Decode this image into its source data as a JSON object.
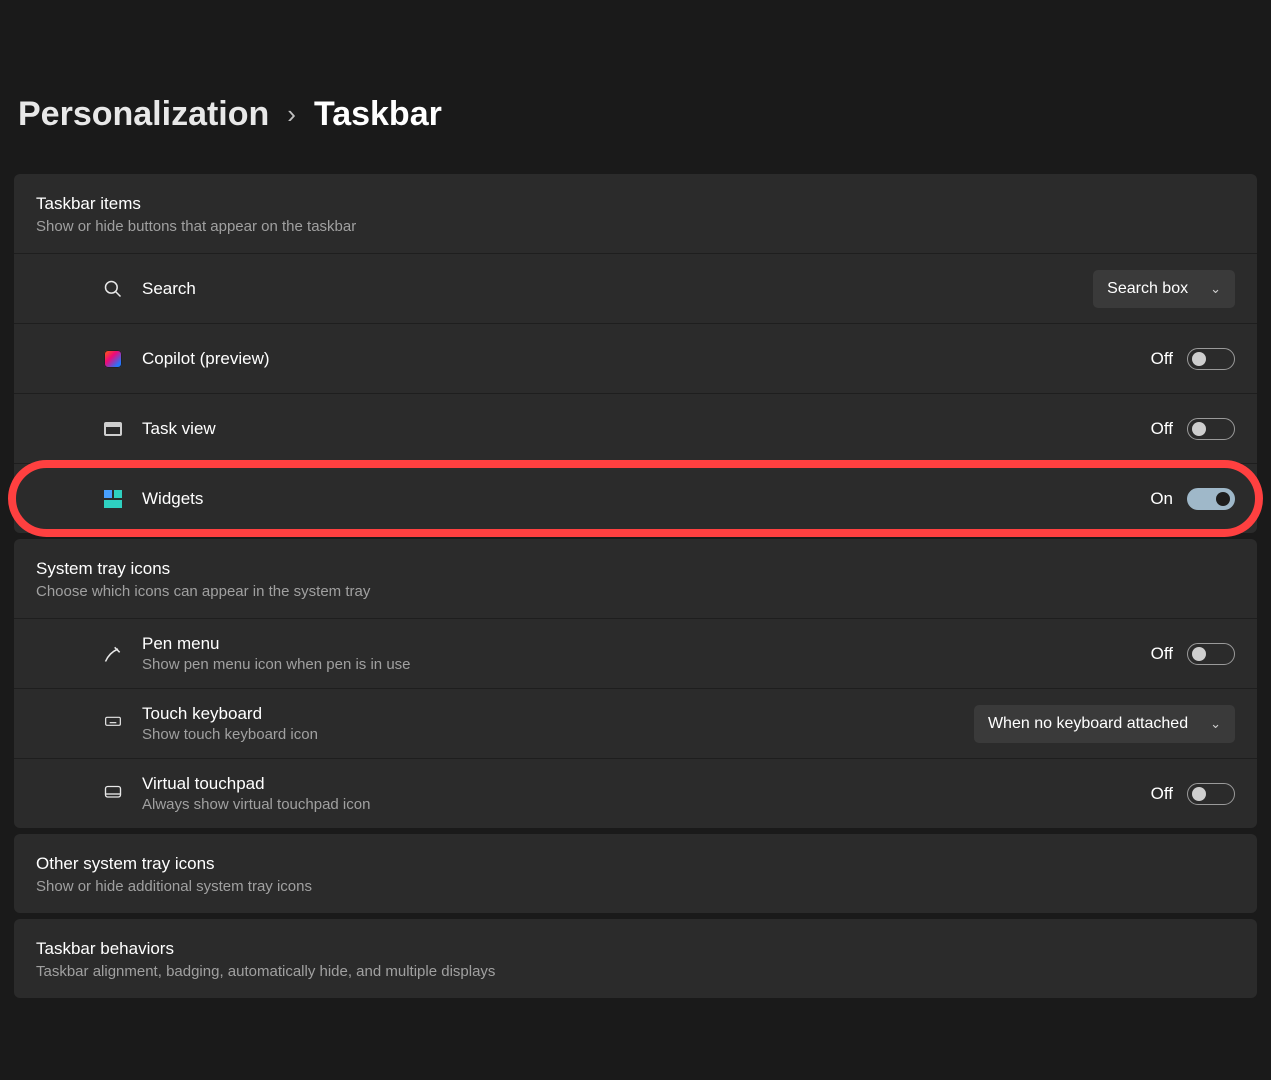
{
  "breadcrumb": {
    "parent": "Personalization",
    "current": "Taskbar"
  },
  "sections": {
    "taskbar_items": {
      "title": "Taskbar items",
      "sub": "Show or hide buttons that appear on the taskbar",
      "search": {
        "label": "Search",
        "dropdown": "Search box"
      },
      "copilot": {
        "label": "Copilot (preview)",
        "state": "Off",
        "on": false
      },
      "taskview": {
        "label": "Task view",
        "state": "Off",
        "on": false
      },
      "widgets": {
        "label": "Widgets",
        "state": "On",
        "on": true
      }
    },
    "system_tray": {
      "title": "System tray icons",
      "sub": "Choose which icons can appear in the system tray",
      "pen": {
        "label": "Pen menu",
        "sub": "Show pen menu icon when pen is in use",
        "state": "Off",
        "on": false
      },
      "touch": {
        "label": "Touch keyboard",
        "sub": "Show touch keyboard icon",
        "dropdown": "When no keyboard attached"
      },
      "vtp": {
        "label": "Virtual touchpad",
        "sub": "Always show virtual touchpad icon",
        "state": "Off",
        "on": false
      }
    },
    "other_tray": {
      "title": "Other system tray icons",
      "sub": "Show or hide additional system tray icons"
    },
    "behaviors": {
      "title": "Taskbar behaviors",
      "sub": "Taskbar alignment, badging, automatically hide, and multiple displays"
    }
  }
}
